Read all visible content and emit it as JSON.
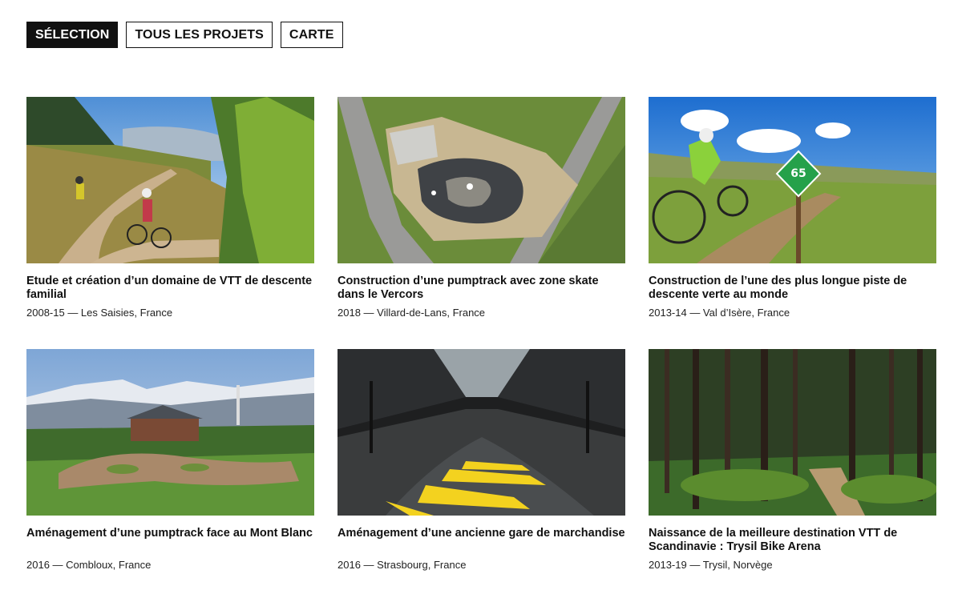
{
  "tabs": [
    {
      "label": "SÉLECTION"
    },
    {
      "label": "TOUS LES PROJETS"
    },
    {
      "label": "CARTE"
    }
  ],
  "projects": [
    {
      "title": "Etude et création d’un domaine de VTT de descente familial",
      "meta": "2008-15 — Les Saisies, France",
      "image": "mountain-bikers-on-wooden-boardwalk-in-forest"
    },
    {
      "title": "Construction d’une pumptrack avec zone skate dans le Vercors",
      "meta": "2018 — Villard-de-Lans, France",
      "image": "aerial-view-of-pumptrack-and-skate-area"
    },
    {
      "title": "Construction de l’une des plus longue piste de descente verte au monde",
      "meta": "2013-14 — Val d’Isère, France",
      "image": "mountain-biker-next-to-green-trail-sign"
    },
    {
      "title": "Aménagement d’une pumptrack face au Mont Blanc",
      "meta": "2016 — Combloux, France",
      "image": "pumptrack-in-alpine-village-facing-mont-blanc"
    },
    {
      "title": "Aménagement d’une ancienne gare de marchandise",
      "meta": "2016 — Strasbourg, France",
      "image": "indoor-pumptrack-in-old-freight-station"
    },
    {
      "title": "Naissance de la meilleure destination VTT de Scandinavie : Trysil Bike Arena",
      "meta": "2013-19 — Trysil, Norvège",
      "image": "wooden-boardwalk-trail-in-pine-forest"
    }
  ]
}
